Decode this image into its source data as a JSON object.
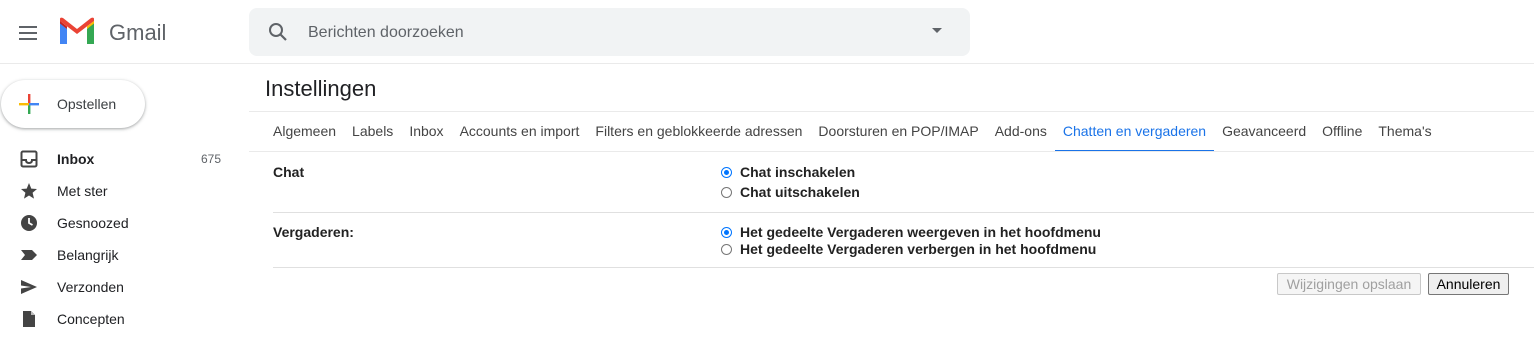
{
  "app": {
    "brand": "Gmail"
  },
  "search": {
    "placeholder": "Berichten doorzoeken"
  },
  "compose": {
    "label": "Opstellen"
  },
  "nav": [
    {
      "label": "Inbox",
      "count": "675",
      "icon": "inbox-icon"
    },
    {
      "label": "Met ster",
      "count": "",
      "icon": "star-icon"
    },
    {
      "label": "Gesnoozed",
      "count": "",
      "icon": "clock-icon"
    },
    {
      "label": "Belangrijk",
      "count": "",
      "icon": "important-icon"
    },
    {
      "label": "Verzonden",
      "count": "",
      "icon": "send-icon"
    },
    {
      "label": "Concepten",
      "count": "",
      "icon": "draft-icon"
    }
  ],
  "settings": {
    "title": "Instellingen",
    "tabs": [
      {
        "label": "Algemeen"
      },
      {
        "label": "Labels"
      },
      {
        "label": "Inbox"
      },
      {
        "label": "Accounts en import"
      },
      {
        "label": "Filters en geblokkeerde adressen"
      },
      {
        "label": "Doorsturen en POP/IMAP"
      },
      {
        "label": "Add-ons"
      },
      {
        "label": "Chatten en vergaderen"
      },
      {
        "label": "Geavanceerd"
      },
      {
        "label": "Offline"
      },
      {
        "label": "Thema's"
      }
    ],
    "active_tab": "Chatten en vergaderen",
    "chat": {
      "label": "Chat",
      "options": [
        "Chat inschakelen",
        "Chat uitschakelen"
      ],
      "selected": "Chat inschakelen"
    },
    "meet": {
      "label": "Vergaderen:",
      "options": [
        "Het gedeelte Vergaderen weergeven in het hoofdmenu",
        "Het gedeelte Vergaderen verbergen in het hoofdmenu"
      ],
      "selected": "Het gedeelte Vergaderen weergeven in het hoofdmenu"
    },
    "buttons": {
      "save": "Wijzigingen opslaan",
      "cancel": "Annuleren"
    }
  },
  "colors": {
    "accent": "#1a73e8",
    "radio": "#0075ff"
  }
}
